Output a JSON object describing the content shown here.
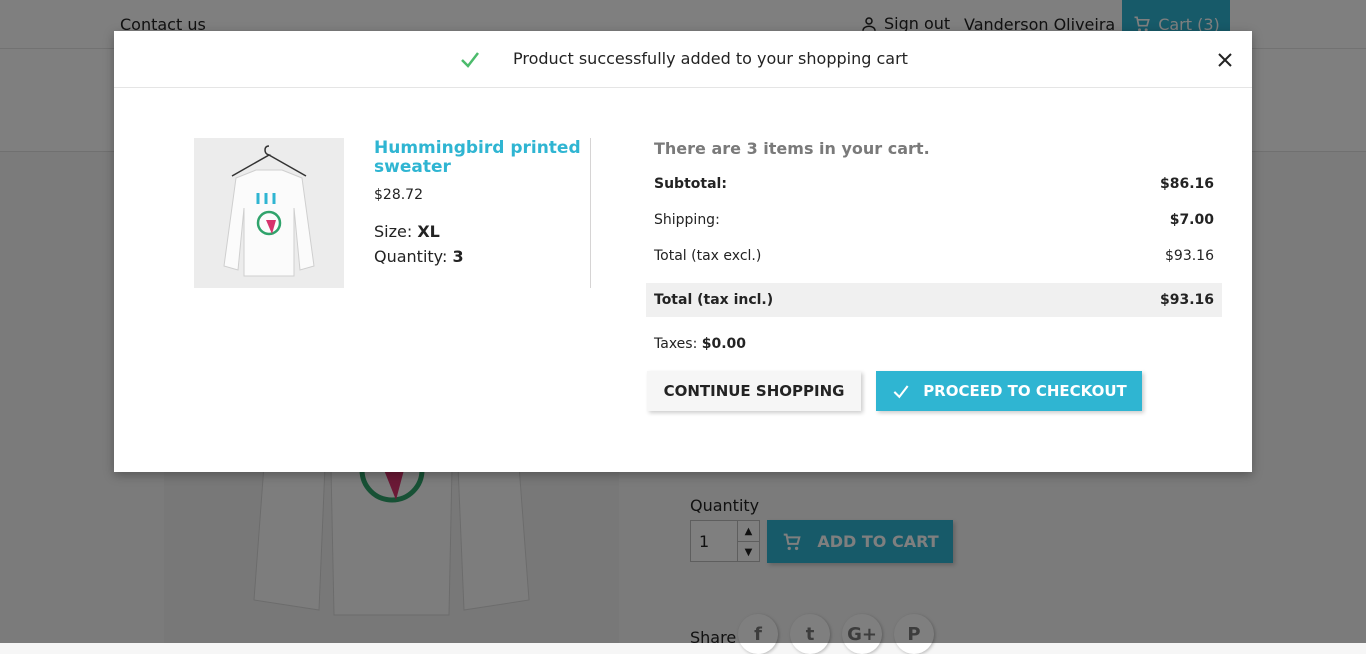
{
  "header": {
    "contact_label": "Contact us",
    "signout_label": "Sign out",
    "username": "Vanderson Oliveira",
    "cart_label": "Cart (3)"
  },
  "product_page": {
    "quantity_label": "Quantity",
    "quantity_value": "1",
    "add_to_cart_label": "ADD TO CART",
    "share_label": "Share",
    "share_icons": [
      "facebook-icon",
      "twitter-icon",
      "google-plus-icon",
      "pinterest-icon"
    ],
    "share_glyphs": [
      "f",
      "t",
      "G+",
      "P"
    ]
  },
  "modal": {
    "title": "Product successfully added to your shopping cart",
    "product": {
      "name": "Hummingbird printed sweater",
      "price": "$28.72",
      "size_label": "Size:",
      "size_value": "XL",
      "quantity_label": "Quantity:",
      "quantity_value": "3"
    },
    "cart_summary": {
      "items_text": "There are 3 items in your cart.",
      "subtotal_label": "Subtotal:",
      "subtotal_value": "$86.16",
      "shipping_label": "Shipping:",
      "shipping_value": "$7.00",
      "total_excl_label": "Total (tax excl.)",
      "total_excl_value": "$93.16",
      "total_incl_label": "Total (tax incl.)",
      "total_incl_value": "$93.16",
      "taxes_label": "Taxes:",
      "taxes_value": "$0.00"
    },
    "continue_label": "CONTINUE SHOPPING",
    "checkout_label": "PROCEED TO CHECKOUT"
  },
  "colors": {
    "accent": "#2fb5d2",
    "success": "#4cbb6c",
    "overlay": "rgba(0,0,0,0.5)"
  }
}
